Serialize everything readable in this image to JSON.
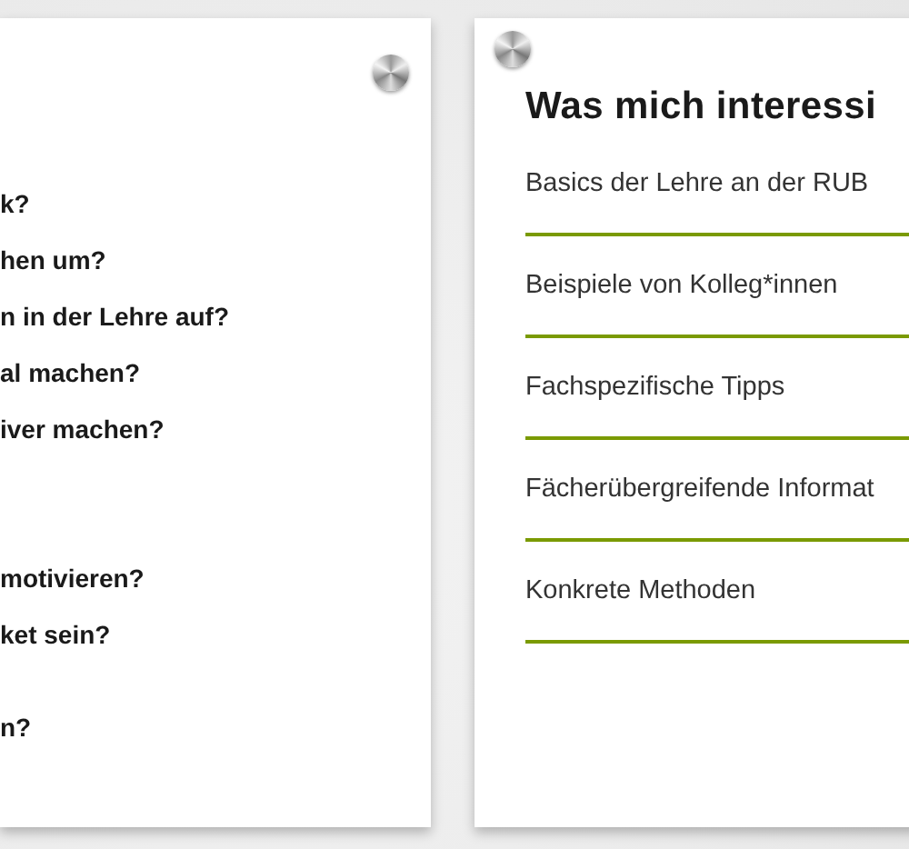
{
  "left_card": {
    "questions": [
      "k?",
      "hen um?",
      "n in der Lehre auf?",
      "al machen?",
      "iver machen?",
      "motivieren?",
      "ket sein?",
      "n?"
    ]
  },
  "right_card": {
    "title": "Was mich interessi",
    "links": [
      "Basics der Lehre an der RUB",
      "Beispiele von Kolleg*innen",
      "Fachspezifische Tipps",
      "Fächerübergreifende Informat",
      "Konkrete Methoden"
    ]
  }
}
